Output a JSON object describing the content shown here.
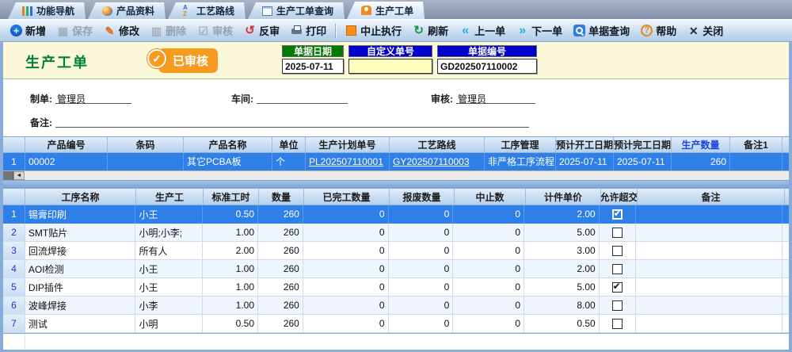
{
  "tabs": [
    {
      "label": "功能导航"
    },
    {
      "label": "产品资料"
    },
    {
      "label": "工艺路线"
    },
    {
      "label": "生产工单查询"
    },
    {
      "label": "生产工单"
    }
  ],
  "toolbar": {
    "items": [
      {
        "label": "新增",
        "enabled": true
      },
      {
        "label": "保存",
        "enabled": false
      },
      {
        "label": "修改",
        "enabled": true
      },
      {
        "label": "删除",
        "enabled": false
      },
      {
        "label": "审核",
        "enabled": false
      },
      {
        "label": "反审",
        "enabled": true
      },
      {
        "label": "打印",
        "enabled": true
      },
      {
        "label": "中止执行",
        "enabled": true
      },
      {
        "label": "刷新",
        "enabled": true
      },
      {
        "label": "上一单",
        "enabled": true
      },
      {
        "label": "下一单",
        "enabled": true
      },
      {
        "label": "单据查询",
        "enabled": true
      },
      {
        "label": "帮助",
        "enabled": true
      },
      {
        "label": "关闭",
        "enabled": true
      }
    ]
  },
  "icons": {
    "add": "+",
    "save": "▦",
    "edit": "✎",
    "delete": "▥",
    "audit": "☑",
    "unaudit": "↺",
    "refresh": "↻",
    "prev": "«",
    "next": "»",
    "help": "?",
    "close": "✕",
    "shield_check": "✓",
    "scroll_left": "◄"
  },
  "header": {
    "title": "生产工单",
    "status_badge": "已审核",
    "fields": [
      {
        "label": "单据日期",
        "value": "2025-07-11",
        "header_color": "#007a00",
        "value_bg": "#ffffff"
      },
      {
        "label": "自定义单号",
        "value": "",
        "header_color": "#0000cc",
        "value_bg": "#ffffc0"
      },
      {
        "label": "单据编号",
        "value": "GD202507110002",
        "header_color": "#0000cc",
        "value_bg": "#ffffff"
      }
    ]
  },
  "form": {
    "maker_label": "制单:",
    "maker_value": "管理员",
    "workshop_label": "车间:",
    "workshop_value": "",
    "auditor_label": "审核:",
    "auditor_value": "管理员",
    "remark_label": "备注:",
    "remark_value": ""
  },
  "product_table": {
    "columns": [
      "产品编号",
      "条码",
      "产品名称",
      "单位",
      "生产计划单号",
      "工艺路线",
      "工序管理",
      "预计开工日期",
      "预计完工日期",
      "生产数量",
      "备注1"
    ],
    "rows": [
      {
        "num": "1",
        "code": "00002",
        "barcode": "",
        "name": "其它PCBA板",
        "unit": "个",
        "plan_no": "PL202507110001",
        "route_no": "GY202507110003",
        "process_mgmt": "非严格工序流程",
        "start_date": "2025-07-11",
        "finish_date": "2025-07-11",
        "qty": "260",
        "note1": ""
      }
    ]
  },
  "process_table": {
    "columns": [
      "工序名称",
      "生产工",
      "标准工时",
      "数量",
      "已完工数量",
      "报废数量",
      "中止数",
      "计件单价",
      "允许超交",
      "备注"
    ],
    "rows": [
      {
        "num": "1",
        "name": "锡膏印刷",
        "worker": "小王",
        "std_hours": "0.50",
        "qty": "260",
        "done_qty": "0",
        "scrap_qty": "0",
        "halt_qty": "0",
        "piece_price": "2.00",
        "allow_over": true,
        "note": ""
      },
      {
        "num": "2",
        "name": "SMT贴片",
        "worker": "小明;小李;",
        "std_hours": "1.00",
        "qty": "260",
        "done_qty": "0",
        "scrap_qty": "0",
        "halt_qty": "0",
        "piece_price": "5.00",
        "allow_over": false,
        "note": ""
      },
      {
        "num": "3",
        "name": "回流焊接",
        "worker": "所有人",
        "std_hours": "2.00",
        "qty": "260",
        "done_qty": "0",
        "scrap_qty": "0",
        "halt_qty": "0",
        "piece_price": "3.00",
        "allow_over": false,
        "note": ""
      },
      {
        "num": "4",
        "name": "AOI检测",
        "worker": "小王",
        "std_hours": "1.00",
        "qty": "260",
        "done_qty": "0",
        "scrap_qty": "0",
        "halt_qty": "0",
        "piece_price": "2.00",
        "allow_over": false,
        "note": ""
      },
      {
        "num": "5",
        "name": "DIP插件",
        "worker": "小王",
        "std_hours": "1.00",
        "qty": "260",
        "done_qty": "0",
        "scrap_qty": "0",
        "halt_qty": "0",
        "piece_price": "5.00",
        "allow_over": true,
        "note": ""
      },
      {
        "num": "6",
        "name": "波峰焊接",
        "worker": "小李",
        "std_hours": "1.00",
        "qty": "260",
        "done_qty": "0",
        "scrap_qty": "0",
        "halt_qty": "0",
        "piece_price": "8.00",
        "allow_over": false,
        "note": ""
      },
      {
        "num": "7",
        "name": "测试",
        "worker": "小明",
        "std_hours": "0.50",
        "qty": "260",
        "done_qty": "0",
        "scrap_qty": "0",
        "halt_qty": "0",
        "piece_price": "0.50",
        "allow_over": false,
        "note": ""
      }
    ]
  },
  "colors": {
    "selected_row": "#2e7fe8",
    "badge_orange": "#f79b1e",
    "title_green": "#00803c"
  }
}
